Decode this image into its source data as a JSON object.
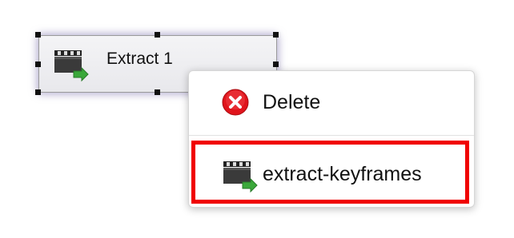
{
  "node": {
    "label": "Extract 1",
    "icon": "clapperboard-extract-icon"
  },
  "context_menu": {
    "items": [
      {
        "label": "Delete",
        "icon": "delete-icon"
      },
      {
        "label": "extract-keyframes",
        "icon": "clapperboard-extract-icon",
        "highlighted": true
      }
    ]
  },
  "colors": {
    "highlight": "#f00000",
    "delete_icon": "#e0141c",
    "arrow_green": "#3aa83a",
    "selection_glow": "#786eaa"
  }
}
